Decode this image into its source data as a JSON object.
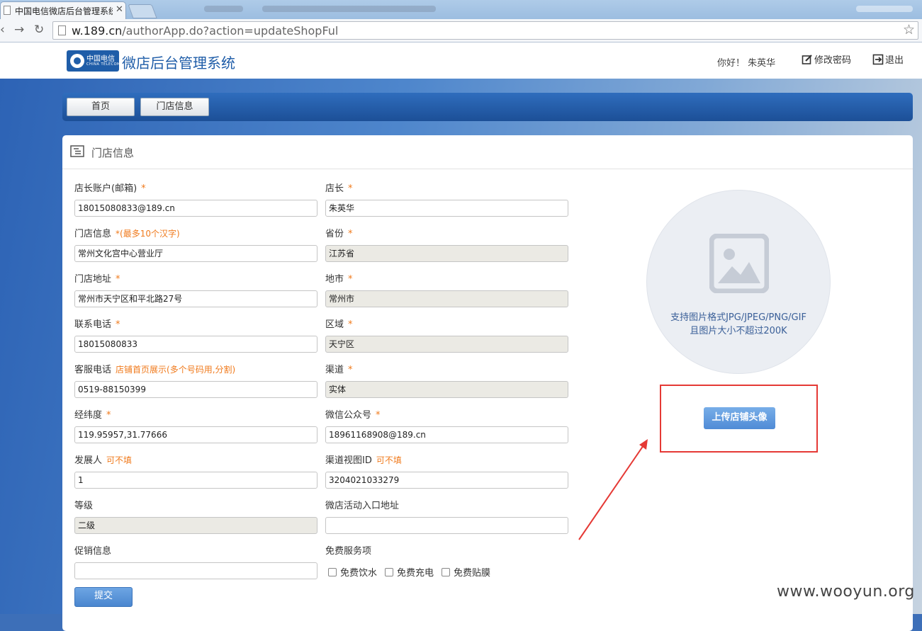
{
  "browser": {
    "tab_title": "中国电信微店后台管理系统",
    "url_host": "w.189.cn",
    "url_path": "/authorApp.do?action=updateShopFul"
  },
  "header": {
    "logo_cn": "中国电信",
    "logo_en": "CHINA TELECOM",
    "system_title": "微店后台管理系统",
    "greeting": "你好！ 朱英华",
    "change_password": "修改密码",
    "logout": "退出"
  },
  "nav": {
    "home": "首页",
    "store_info": "门店信息"
  },
  "panel": {
    "title": "门店信息"
  },
  "form": {
    "owner_account": {
      "label": "店长账户(邮箱)",
      "required": "*",
      "value": "18015080833@189.cn"
    },
    "owner": {
      "label": "店长",
      "required": "*",
      "value": "朱英华"
    },
    "store_info": {
      "label": "门店信息",
      "note": "*(最多10个汉字)",
      "value": "常州文化宫中心营业厅"
    },
    "province": {
      "label": "省份",
      "required": "*",
      "value": "江苏省"
    },
    "store_address": {
      "label": "门店地址",
      "required": "*",
      "value": "常州市天宁区和平北路27号"
    },
    "city": {
      "label": "地市",
      "required": "*",
      "value": "常州市"
    },
    "phone": {
      "label": "联系电话",
      "required": "*",
      "value": "18015080833"
    },
    "district": {
      "label": "区域",
      "required": "*",
      "value": "天宁区"
    },
    "service_phone": {
      "label": "客服电话",
      "note": "店铺首页展示(多个号码用,分割)",
      "value": "0519-88150399"
    },
    "channel": {
      "label": "渠道",
      "required": "*",
      "value": "实体"
    },
    "coordinates": {
      "label": "经纬度",
      "required": "*",
      "value": "119.95957,31.77666"
    },
    "wechat": {
      "label": "微信公众号",
      "required": "*",
      "value": "18961168908@189.cn"
    },
    "developer": {
      "label": "发展人",
      "note": "可不填",
      "value": "1"
    },
    "channel_view_id": {
      "label": "渠道视图ID",
      "note": "可不填",
      "value": "3204021033279"
    },
    "level": {
      "label": "等级",
      "value": "二级"
    },
    "activity_entry": {
      "label": "微店活动入口地址",
      "value": ""
    },
    "promotion": {
      "label": "促销信息",
      "value": ""
    },
    "free_services": {
      "label": "免费服务项",
      "options": [
        "免费饮水",
        "免费充电",
        "免费贴膜"
      ]
    },
    "submit": "提交"
  },
  "upload": {
    "tip_line1": "支持图片格式JPG/JPEG/PNG/GIF",
    "tip_line2": "且图片大小不超过200K",
    "button": "上传店铺头像"
  },
  "watermark": "www.wooyun.org",
  "colors": {
    "brand_blue": "#1f5da8",
    "required_orange": "#f07a1c",
    "highlight_red": "#e53935"
  }
}
